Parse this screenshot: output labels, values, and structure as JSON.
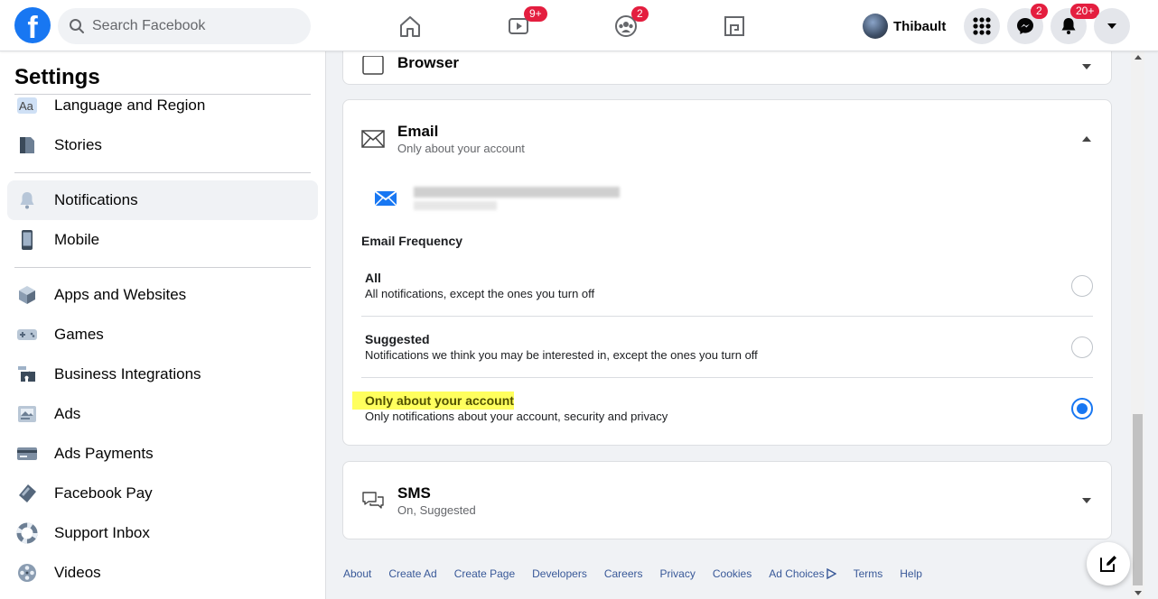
{
  "topbar": {
    "logo": "f",
    "search_placeholder": "Search Facebook",
    "watch_badge": "9+",
    "groups_badge": "2",
    "user_name": "Thibault",
    "messenger_badge": "2",
    "notifications_badge": "20+"
  },
  "sidebar": {
    "title": "Settings",
    "items": [
      {
        "label": "Language and Region",
        "icon": "language-icon"
      },
      {
        "label": "Stories",
        "icon": "stories-icon"
      },
      {
        "label": "Notifications",
        "icon": "bell-icon"
      },
      {
        "label": "Mobile",
        "icon": "mobile-icon"
      },
      {
        "label": "Apps and Websites",
        "icon": "cube-icon"
      },
      {
        "label": "Games",
        "icon": "gamepad-icon"
      },
      {
        "label": "Business Integrations",
        "icon": "puzzle-icon"
      },
      {
        "label": "Ads",
        "icon": "ads-icon"
      },
      {
        "label": "Ads Payments",
        "icon": "credit-card-icon"
      },
      {
        "label": "Facebook Pay",
        "icon": "pay-icon"
      },
      {
        "label": "Support Inbox",
        "icon": "lifebuoy-icon"
      },
      {
        "label": "Videos",
        "icon": "film-reel-icon"
      }
    ],
    "active": "Notifications"
  },
  "main": {
    "browser_card": {
      "title": "Browser"
    },
    "email_card": {
      "title": "Email",
      "subtitle": "Only about your account",
      "frequency_title": "Email Frequency",
      "options": [
        {
          "title": "All",
          "desc": "All notifications, except the ones you turn off",
          "selected": false
        },
        {
          "title": "Suggested",
          "desc": "Notifications we think you may be interested in, except the ones you turn off",
          "selected": false
        },
        {
          "title": "Only about your account",
          "desc": "Only notifications about your account, security and privacy",
          "selected": true
        }
      ]
    },
    "sms_card": {
      "title": "SMS",
      "subtitle": "On, Suggested"
    }
  },
  "footer": {
    "links": [
      "About",
      "Create Ad",
      "Create Page",
      "Developers",
      "Careers",
      "Privacy",
      "Cookies",
      "Ad Choices",
      "Terms",
      "Help"
    ]
  },
  "colors": {
    "brand": "#1877f2",
    "badge": "#e41e3f",
    "highlight": "#ffff5e"
  }
}
